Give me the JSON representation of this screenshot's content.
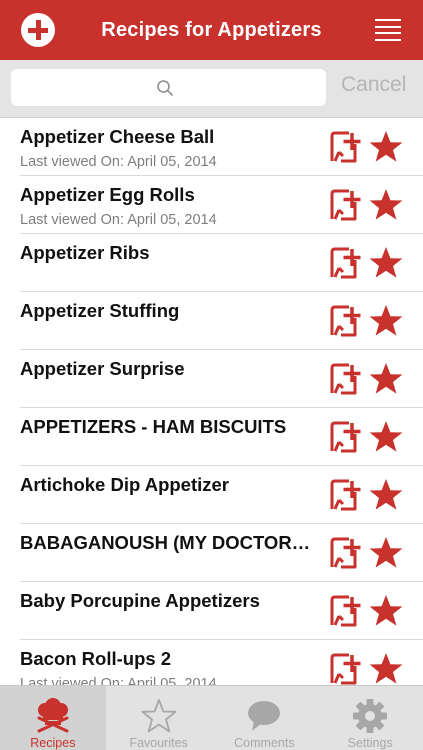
{
  "header": {
    "title": "Recipes for Appetizers"
  },
  "search": {
    "placeholder": "",
    "cancel_label": "Cancel"
  },
  "recipes": [
    {
      "title": "Appetizer Cheese Ball",
      "subtitle": "Last viewed On: April 05, 2014"
    },
    {
      "title": "Appetizer Egg Rolls",
      "subtitle": "Last viewed On: April 05, 2014"
    },
    {
      "title": "Appetizer Ribs",
      "subtitle": ""
    },
    {
      "title": "Appetizer Stuffing",
      "subtitle": ""
    },
    {
      "title": "Appetizer Surprise",
      "subtitle": ""
    },
    {
      "title": "APPETIZERS - HAM BISCUITS",
      "subtitle": ""
    },
    {
      "title": "Artichoke Dip Appetizer",
      "subtitle": ""
    },
    {
      "title": "BABAGANOUSH (MY DOCTOR…",
      "subtitle": ""
    },
    {
      "title": "Baby Porcupine Appetizers",
      "subtitle": ""
    },
    {
      "title": "Bacon Roll-ups 2",
      "subtitle": "Last viewed On: April 05, 2014"
    }
  ],
  "tabs": [
    {
      "label": "Recipes",
      "icon": "chef-hat-icon",
      "active": true
    },
    {
      "label": "Favourites",
      "icon": "star-outline-icon",
      "active": false
    },
    {
      "label": "Comments",
      "icon": "speech-bubble-icon",
      "active": false
    },
    {
      "label": "Settings",
      "icon": "gear-icon",
      "active": false
    }
  ],
  "colors": {
    "accent": "#c8312c",
    "tab_inactive": "#a7a7a7",
    "searchbar_bg": "#e4e4e4"
  }
}
